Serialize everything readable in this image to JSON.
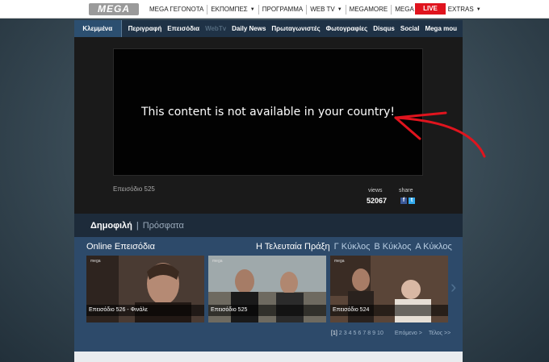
{
  "topbar": {
    "logo": "MEGA",
    "items": [
      {
        "label": "MEGA ΓΕΓΟΝΟΤΑ",
        "caret": false
      },
      {
        "label": "ΕΚΠΟΜΠΕΣ",
        "caret": true
      },
      {
        "label": "ΠΡΟΓΡΑΜΜΑ",
        "caret": false
      },
      {
        "label": "WEB TV",
        "caret": true
      },
      {
        "label": "MEGAMORE",
        "caret": false
      },
      {
        "label": "MEGA CINEMA",
        "caret": false
      },
      {
        "label": "EXTRAS",
        "caret": true
      }
    ],
    "live_label": "LIVE",
    "live_color": "#e0141e"
  },
  "show_nav": {
    "title": "Κλεμμένα Όνειρα",
    "links": [
      "Περιγραφή",
      "Επεισόδια",
      "WebTv",
      "Daily News",
      "Πρωταγωνιστές",
      "Φωτογραφίες",
      "Disqus",
      "Social",
      "Mega mou"
    ],
    "active_index": 2
  },
  "player": {
    "message": "This content is not available in your country!",
    "episode_label": "Επεισόδιο 525",
    "views_label": "views",
    "views_count": "52067",
    "share_label": "share",
    "share_icons": [
      "facebook-icon",
      "twitter-icon"
    ],
    "annotation_color": "#e0141e"
  },
  "tabs": {
    "active": "Δημοφιλή",
    "separator": "|",
    "inactive": "Πρόσφατα"
  },
  "episodes": {
    "heading": "Online Επεισόδια",
    "filters": [
      "Η Τελευταία Πράξη",
      "Γ Κύκλος",
      "Β Κύκλος",
      "Α Κύκλος"
    ],
    "items": [
      {
        "caption": "Επεισόδιο 526 - Φινάλε",
        "brand": "mega"
      },
      {
        "caption": "Επεισόδιο 525",
        "brand": "mega"
      },
      {
        "caption": "Επεισόδιο 524",
        "brand": "mega"
      }
    ],
    "pager": {
      "current": "[1]",
      "pages": [
        "2",
        "3",
        "4",
        "5",
        "6",
        "7",
        "8",
        "9",
        "10"
      ],
      "next": "Επόμενο >",
      "last": "Τέλος >>"
    }
  }
}
